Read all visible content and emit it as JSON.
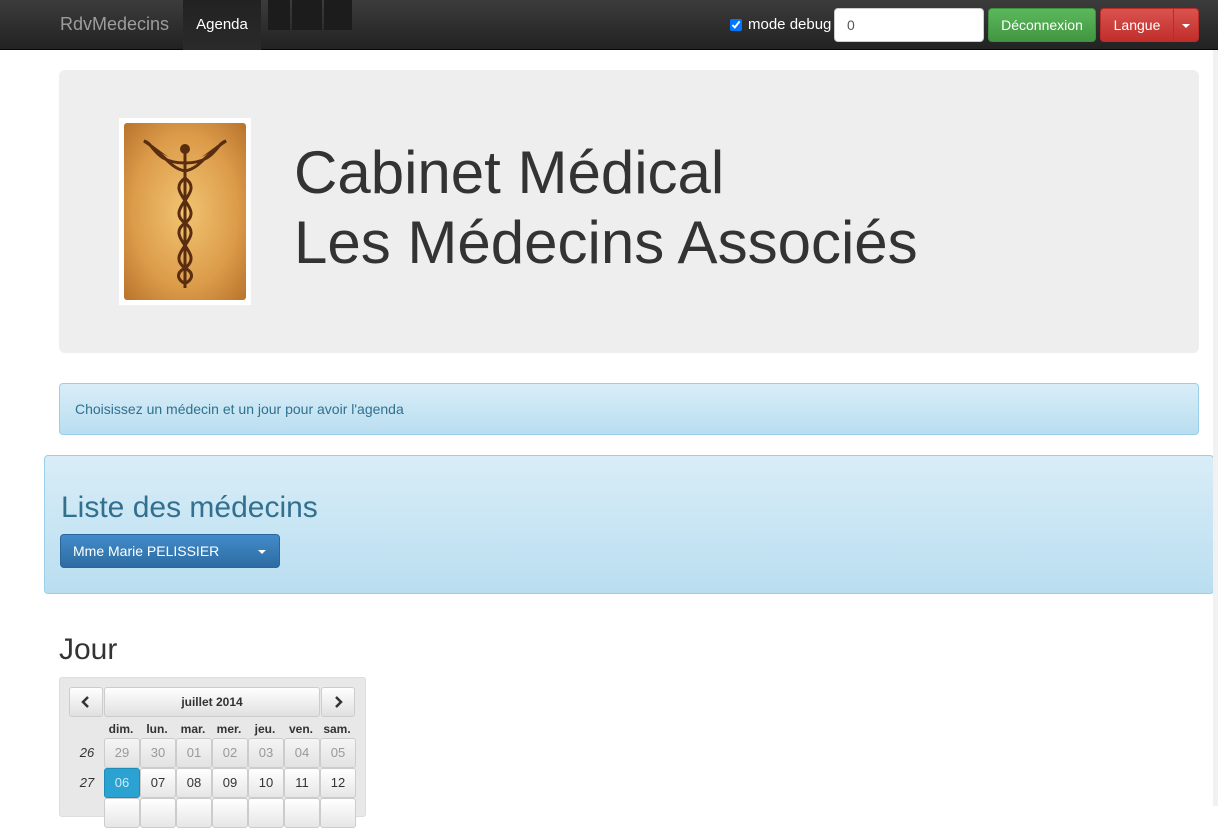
{
  "navbar": {
    "brand": "RdvMedecins",
    "active_item": "Agenda",
    "debug_label": "mode debug",
    "debug_checked": true,
    "number_input_value": "0",
    "logout_label": "Déconnexion",
    "language_label": "Langue"
  },
  "jumbotron": {
    "title_line1": "Cabinet Médical",
    "title_line2": "Les Médecins Associés"
  },
  "alert": {
    "text": "Choisissez un médecin et un jour pour avoir l'agenda"
  },
  "doctors": {
    "heading": "Liste des médecins",
    "selected": "Mme Marie PELISSIER"
  },
  "day": {
    "heading": "Jour"
  },
  "calendar": {
    "month_label": "juillet 2014",
    "weekdays": [
      "dim.",
      "lun.",
      "mar.",
      "mer.",
      "jeu.",
      "ven.",
      "sam."
    ],
    "weeks": [
      {
        "number": "26",
        "days": [
          "29",
          "30",
          "01",
          "02",
          "03",
          "04",
          "05"
        ]
      },
      {
        "number": "27",
        "days": [
          "06",
          "07",
          "08",
          "09",
          "10",
          "11",
          "12"
        ]
      }
    ],
    "selected_day": "06"
  },
  "colors": {
    "success": "#5cb85c",
    "danger": "#d9534f",
    "primary": "#428bca",
    "info_bg": "#d9edf7"
  }
}
